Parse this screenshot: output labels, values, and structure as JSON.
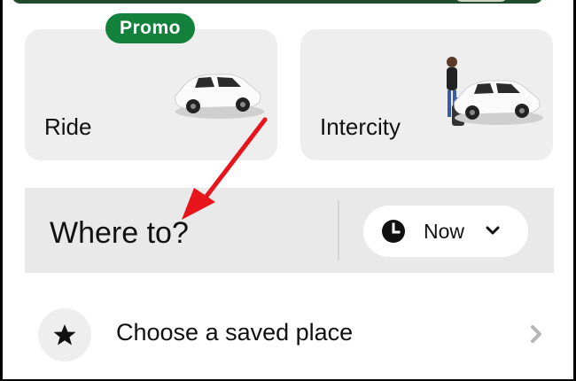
{
  "services": {
    "ride": {
      "label": "Ride",
      "badge": "Promo",
      "icon": "car-icon"
    },
    "intercity": {
      "label": "Intercity",
      "icon": "car-with-traveler-icon"
    }
  },
  "search": {
    "label": "Where to?",
    "schedule_label": "Now",
    "schedule_icon": "clock-icon"
  },
  "saved_place": {
    "label": "Choose a saved place",
    "icon": "star-icon"
  },
  "colors": {
    "promo_green": "#13803c",
    "card_bg": "#eeeeee",
    "search_bg": "#e9e9e9",
    "annotation_red": "#e8141b"
  }
}
